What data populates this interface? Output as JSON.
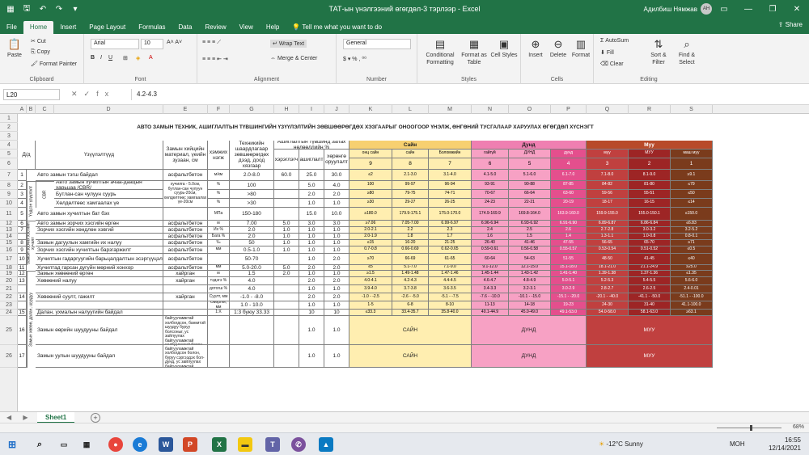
{
  "window": {
    "title": "ТАТ-ын үнэлгээний өгөгдөл-3 тэрлээр  -  Excel",
    "user": "Адилбиш Нямжав",
    "user_initials": "АН"
  },
  "menu": {
    "file": "File",
    "tabs": [
      "Home",
      "Insert",
      "Page Layout",
      "Formulas",
      "Data",
      "Review",
      "View",
      "Help"
    ],
    "tell": "Tell me what you want to do",
    "share": "Share"
  },
  "ribbon": {
    "clipboard": {
      "paste": "Paste",
      "cut": "Cut",
      "copy": "Copy",
      "format_painter": "Format Painter",
      "label": "Clipboard"
    },
    "font": {
      "name": "Arial",
      "size": "10",
      "label": "Font"
    },
    "alignment": {
      "wrap": "Wrap Text",
      "merge": "Merge & Center",
      "label": "Alignment"
    },
    "number": {
      "format": "General",
      "label": "Number"
    },
    "styles": {
      "conditional": "Conditional Formatting",
      "format_table": "Format as Table",
      "cell_styles": "Cell Styles",
      "label": "Styles"
    },
    "cells": {
      "insert": "Insert",
      "delete": "Delete",
      "format": "Format",
      "label": "Cells"
    },
    "editing": {
      "autosum": "AutoSum",
      "fill": "Fill",
      "clear": "Clear",
      "sort": "Sort & Filter",
      "find": "Find & Select",
      "label": "Editing"
    }
  },
  "formula": {
    "cell": "L20",
    "value": "4.2-4.3"
  },
  "columns": [
    "A",
    "B",
    "C",
    "D",
    "E",
    "F",
    "G",
    "H",
    "I",
    "J",
    "K",
    "L",
    "M",
    "N",
    "O",
    "P",
    "Q",
    "R",
    "S"
  ],
  "row_numbers": [
    "1",
    "2",
    "3",
    "4",
    "5",
    "6",
    "7",
    "8",
    "9",
    "10",
    "11",
    "12",
    "13",
    "14",
    "15",
    "16",
    "17",
    "18",
    "19",
    "20",
    "21",
    "22",
    "23",
    "24",
    "25",
    "26"
  ],
  "sheet": {
    "title": "АВТО ЗАМЫН ТЕХНИК, АШИГЛАЛТЫН ТҮВШИНГИЙН ҮЗҮҮЛЭЛТИЙН ЗӨВШӨӨРӨГДӨХ ХЭЗГААРЫГ ОНООГООР ҮНЭЛЖ,  ӨНГӨНИЙ ТУСГАЛААР ХАРУУЛАХ ӨГӨГДӨЛ ХҮСНЭГТ",
    "hdr": {
      "da": "Д/д",
      "name": "Үзүүлэлтүүд",
      "material": "Замын хийцийн материал, үеийн зузаан, см",
      "unit": "хэмжих нэгж",
      "limit": "Техникийн шаардлагаар зөвшөөрөгдөх дээд, доод хязгаар",
      "group": "Ашиглалтын түвшинд залах нөлөөллийн %",
      "h_cur": "хэрэглэгч",
      "h_use": "ашиглалт",
      "h_env": "хөрөнгө оруулалт",
      "good": "Сайн",
      "mid": "Дунд",
      "bad": "Муу",
      "sub": [
        "онц сайн",
        "сайн",
        "Боломжийн",
        "гайгүй",
        "ДУНД",
        "дунд",
        "муу",
        "МУУ",
        "маш муу"
      ],
      "scores": [
        "9",
        "8",
        "7",
        "6",
        "5",
        "4",
        "3",
        "2",
        "1"
      ]
    },
    "groups": {
      "g1": "Үндсэн үзүүлэлт",
      "g2": "CBR",
      "g3": "Замын зорчих хэсгийн хучилт",
      "g4": "Замын хөвөө, далан, шуудуу"
    },
    "rows": [
      [
        "1",
        "Авто замын тэгш байдал",
        "асфальтбетон",
        "м/км",
        "2.0-8.0",
        "60.0",
        "25.0",
        "30.0",
        "≤2",
        "2.1-3.0",
        "3.1-4.0",
        "4.1-5.0",
        "5.1-6.0",
        "6.1-7.0",
        "7.1-8.0",
        "8.1-9.0",
        "≥9.1"
      ],
      [
        "2",
        "Авто замын хучилтын ачаа-даацын харьцаа /CBR/",
        "хучилга - 5.0см, бутлан-сан чулуун суурь-20см, хөлдөлтөөс хамгаалах үе-20см",
        "%",
        "100",
        "",
        "5.0",
        "4.0",
        "100",
        "99-97",
        "96-94",
        "93-91",
        "90-88",
        "87-85",
        "84-82",
        "81-80",
        "≤79"
      ],
      [
        "3",
        "Бутлан-сан чулуун суурь",
        "",
        "%",
        ">80",
        "",
        "2.0",
        "2.0",
        "≥80",
        "79-75",
        "74-71",
        "70-67",
        "66-64",
        "63-60",
        "59-56",
        "55-51",
        "≤50"
      ],
      [
        "4",
        "Хөлдөлтөөс хамгаалах үе",
        "",
        "%",
        ">30",
        "",
        "1.0",
        "1.0",
        "≥30",
        "29-27",
        "26-25",
        "24-23",
        "22-21",
        "20-19",
        "18-17",
        "16-15",
        "≤14"
      ],
      [
        "5",
        "Авто замын хучилтын бат бэх",
        "",
        "МПа",
        "150-180",
        "",
        "15.0",
        "10.0",
        "≥180.0",
        "179.9-175.1",
        "175.0-170.0",
        "174.9-169.9",
        "169.8-164.0",
        "163.9-160.0",
        "159.9-155.0",
        "155.0-150.1",
        "≤150.0"
      ],
      [
        "6",
        "Авто замын зорчих хэсгийн өргөн",
        "асфальтбетон",
        "м",
        "7.00",
        "5.0",
        "3.0",
        "3.0",
        "≥7.06",
        "7.05-7.00",
        "6.99-6.97",
        "6.96-6.94",
        "6.93-6.92",
        "6.91-6.90",
        "6.89-6.87",
        "6.86-6.84",
        "≤6.83"
      ],
      [
        "7",
        "Зорчих хэсгийн хөндлөн хэвгий",
        "асфальтбетон",
        "Их %",
        "2.0",
        "1.0",
        "1.0",
        "1.0",
        "2.0-2.1",
        "2.2",
        "2.3",
        "2.4",
        "2.5",
        "2.6",
        "2.7-2.8",
        "3.0-3.2",
        "3.2-5.2"
      ],
      [
        "",
        "",
        "асфальтбетон",
        "Бага %",
        "2.0",
        "1.0",
        "1.0",
        "1.0",
        "2.0-1.9",
        "1.8",
        "1.7",
        "1.6",
        "1.5",
        "1.4",
        "1.3-1.1",
        "1.0-0.8",
        "0.8-0.1"
      ],
      [
        "8",
        "Замын дагуулын хамгийн их налуу",
        "асфальтбетон",
        "‰",
        "50",
        "1.0",
        "1.0",
        "1.0",
        "≤15",
        "16-20",
        "21-25",
        "26-40",
        "41-46",
        "47-55",
        "56-65",
        "65-70",
        "≥71"
      ],
      [
        "9",
        "Зорчих хэсгийн хучилтын барзгаржилт",
        "асфальтбетон",
        "мм",
        "0.5-1.0",
        "1.0",
        "1.0",
        "1.0",
        "0.7-0.8",
        "0.66-0.69",
        "0.62-0.65",
        "0.59-0.61",
        "0.56-0.58",
        "0.55-0.57",
        "0.53-0.54",
        "0.51-0.52",
        "≤0.5"
      ],
      [
        "10",
        "Хучилтын гадаргуугийн барьцалдалтын эсэргүүцэл",
        "асфальтбетон",
        "",
        "50-70",
        "",
        "1.0",
        "2.0",
        "≥70",
        "66-69",
        "61-65",
        "60-64",
        "54-63",
        "51-55",
        "48-50",
        "41-45",
        "≤40"
      ],
      [
        "11",
        "Хучилтад гарсан дугуйн мөрний хонхор",
        "асфальтбетон",
        "мм",
        "5.0-20.0",
        "5.0",
        "2.0",
        "2.0",
        "≤5",
        "5.1-7.0",
        "7.1-9.0",
        "9.1-12.0",
        "12.1-15.0",
        "15.1-18.0",
        "18.1-21.0",
        "21.1-24.9",
        "≥25.0"
      ],
      [
        "12",
        "Замын хөвөөний өргөн",
        "хайрган",
        "м",
        "1.5",
        "2.0",
        "1.0",
        "1.0",
        "≥1.5",
        "1.49-1.48",
        "1.47-1.46",
        "1.45-1.44",
        "1.43-1.42",
        "1.41-1.40",
        "1.39-1.38",
        "1.37-1.36",
        "≤1.35"
      ],
      [
        "13",
        "Хөвөөний налуу",
        "хайрган",
        "тэдэгэ %",
        "4.0",
        "",
        "2.0",
        "2.0",
        "4.0-4.1",
        "4.2-4.3",
        "4.4-4.5",
        "4.6-4.7",
        "4.8-4.9",
        "5.0-5.1",
        "5.2-5.3",
        "5.4-5.5",
        "5.6-6.0"
      ],
      [
        "",
        "",
        "",
        "дотогш %",
        "4.0",
        "",
        "1.0",
        "1.0",
        "3.9-4.0",
        "3.7-3.8",
        "3.6-3.5",
        "3.4-3.3",
        "3.2-3.1",
        "3.0-2.9",
        "2.8-2.7",
        "2.6-2.5",
        "2.4-0.01"
      ],
      [
        "14",
        "Хөвөөний суулт, гажилт",
        "хайрган",
        "Суулт, мм",
        "-1.0 - -8.0",
        "",
        "2.0",
        "2.0",
        "-1.0 - -2.5",
        "-2.6 - -5.0",
        "-5.1 - -7.5",
        "-7.6 - -10.0",
        "-10.1 - -15.0",
        "-15.1 - -20.0",
        "-20.1 - -40.0",
        "-41.1 - -50.0",
        "-51.1 - -100.0"
      ],
      [
        "",
        "",
        "",
        "Өвөрлөг, мм",
        "1.0 - 10.0",
        "",
        "1.0",
        "1.0",
        "1-5",
        "6-8",
        "8-10",
        "11-13",
        "14-18",
        "19-23",
        "24-30",
        "31-40",
        "41.1-100.0"
      ],
      [
        "15",
        "Далан, ухмалын налуугийн байдал",
        "",
        "1:Х",
        "1:3 буюу 33.33",
        "",
        "10",
        "10",
        "≤33.3",
        "33.4-35.7",
        "35.8-40.0",
        "40.1-44.9",
        "45.0-49.0",
        "49.1-53.0",
        "54.0-58.0",
        "58.1-63.0",
        "≥63.1"
      ],
      [
        "16",
        "Замын өөрийн шуудууны байдал",
        "Шуудууг сэргээдэн, ус зайлуулах байгууламжтай холбогдсон, банкитэй шуудуу буруу болсоныг, ус зайлуулах байгууламжтай холбогдоогүй болон, буруу сэргээдэх ...",
        "",
        "",
        "",
        "1.0",
        "1.0",
        "САЙН",
        "",
        "",
        "ДУНД",
        "",
        "",
        "МУУ",
        "",
        ""
      ],
      [
        "17",
        "Замын уулын шуудууны байдал",
        "Шуудууг сэргээдэн, ус зайлуулах байгууламжтай холбогдсон болон, буруу сэргээдэх бол-дунд, ус зайлуулах байгууламжтай холбогдоогүй ...",
        "",
        "",
        "",
        "1.0",
        "1.0",
        "САЙН",
        "",
        "",
        "ДУНД",
        "",
        "",
        "МУУ",
        "",
        ""
      ]
    ]
  },
  "sheet_tab": "Sheet1",
  "status": {
    "zoom": "68%"
  },
  "taskbar": {
    "weather": "-12°C  Sunny",
    "lang": "МОН",
    "time": "16:55",
    "date": "12/14/2021"
  },
  "colors": {
    "excel_green": "#217346",
    "good": "#ffeeb0",
    "good_hdr": "#f7d070",
    "mid": "#f7a1c4",
    "mid_hdr": "#ef7fb1",
    "mid_dark": "#e44f8d",
    "bad": "#c0403f",
    "bad_dark": "#9d2525",
    "bad_brown": "#7a3b1c",
    "bad_hdr": "#b84a2a"
  }
}
